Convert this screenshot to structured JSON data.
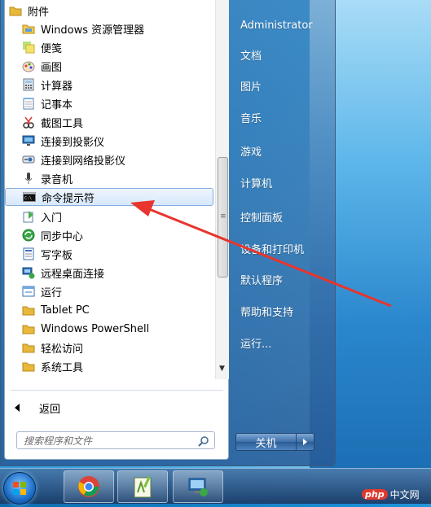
{
  "start_menu": {
    "programs": [
      {
        "label": "附件",
        "icon": "folder-icon",
        "kind": "folder"
      },
      {
        "label": "Windows 资源管理器",
        "icon": "explorer-icon",
        "kind": "sub"
      },
      {
        "label": "便笺",
        "icon": "sticky-notes-icon",
        "kind": "sub"
      },
      {
        "label": "画图",
        "icon": "paint-icon",
        "kind": "sub"
      },
      {
        "label": "计算器",
        "icon": "calculator-icon",
        "kind": "sub"
      },
      {
        "label": "记事本",
        "icon": "notepad-icon",
        "kind": "sub"
      },
      {
        "label": "截图工具",
        "icon": "snipping-tool-icon",
        "kind": "sub"
      },
      {
        "label": "连接到投影仪",
        "icon": "projector-icon",
        "kind": "sub"
      },
      {
        "label": "连接到网络投影仪",
        "icon": "network-projector-icon",
        "kind": "sub"
      },
      {
        "label": "录音机",
        "icon": "microphone-icon",
        "kind": "sub"
      },
      {
        "label": "命令提示符",
        "icon": "cmd-icon",
        "kind": "sub",
        "highlighted": true
      },
      {
        "label": "入门",
        "icon": "getting-started-icon",
        "kind": "sub"
      },
      {
        "label": "同步中心",
        "icon": "sync-center-icon",
        "kind": "sub"
      },
      {
        "label": "写字板",
        "icon": "wordpad-icon",
        "kind": "sub"
      },
      {
        "label": "远程桌面连接",
        "icon": "remote-desktop-icon",
        "kind": "sub"
      },
      {
        "label": "运行",
        "icon": "run-icon",
        "kind": "sub"
      },
      {
        "label": "Tablet PC",
        "icon": "folder-icon",
        "kind": "sub-folder"
      },
      {
        "label": "Windows PowerShell",
        "icon": "folder-icon",
        "kind": "sub-folder"
      },
      {
        "label": "轻松访问",
        "icon": "folder-icon",
        "kind": "sub-folder"
      },
      {
        "label": "系统工具",
        "icon": "folder-icon",
        "kind": "sub-folder"
      }
    ],
    "back_label": "返回",
    "search_placeholder": "搜索程序和文件",
    "right_items": [
      "Administrator",
      "文档",
      "图片",
      "音乐",
      "游戏",
      "计算机",
      "控制面板",
      "设备和打印机",
      "默认程序",
      "帮助和支持",
      "运行..."
    ],
    "shutdown_label": "关机"
  },
  "watermark": {
    "badge": "php",
    "text": "中文网"
  },
  "colors": {
    "annotation_arrow": "#e8352d",
    "highlight_border": "#84acdd"
  }
}
